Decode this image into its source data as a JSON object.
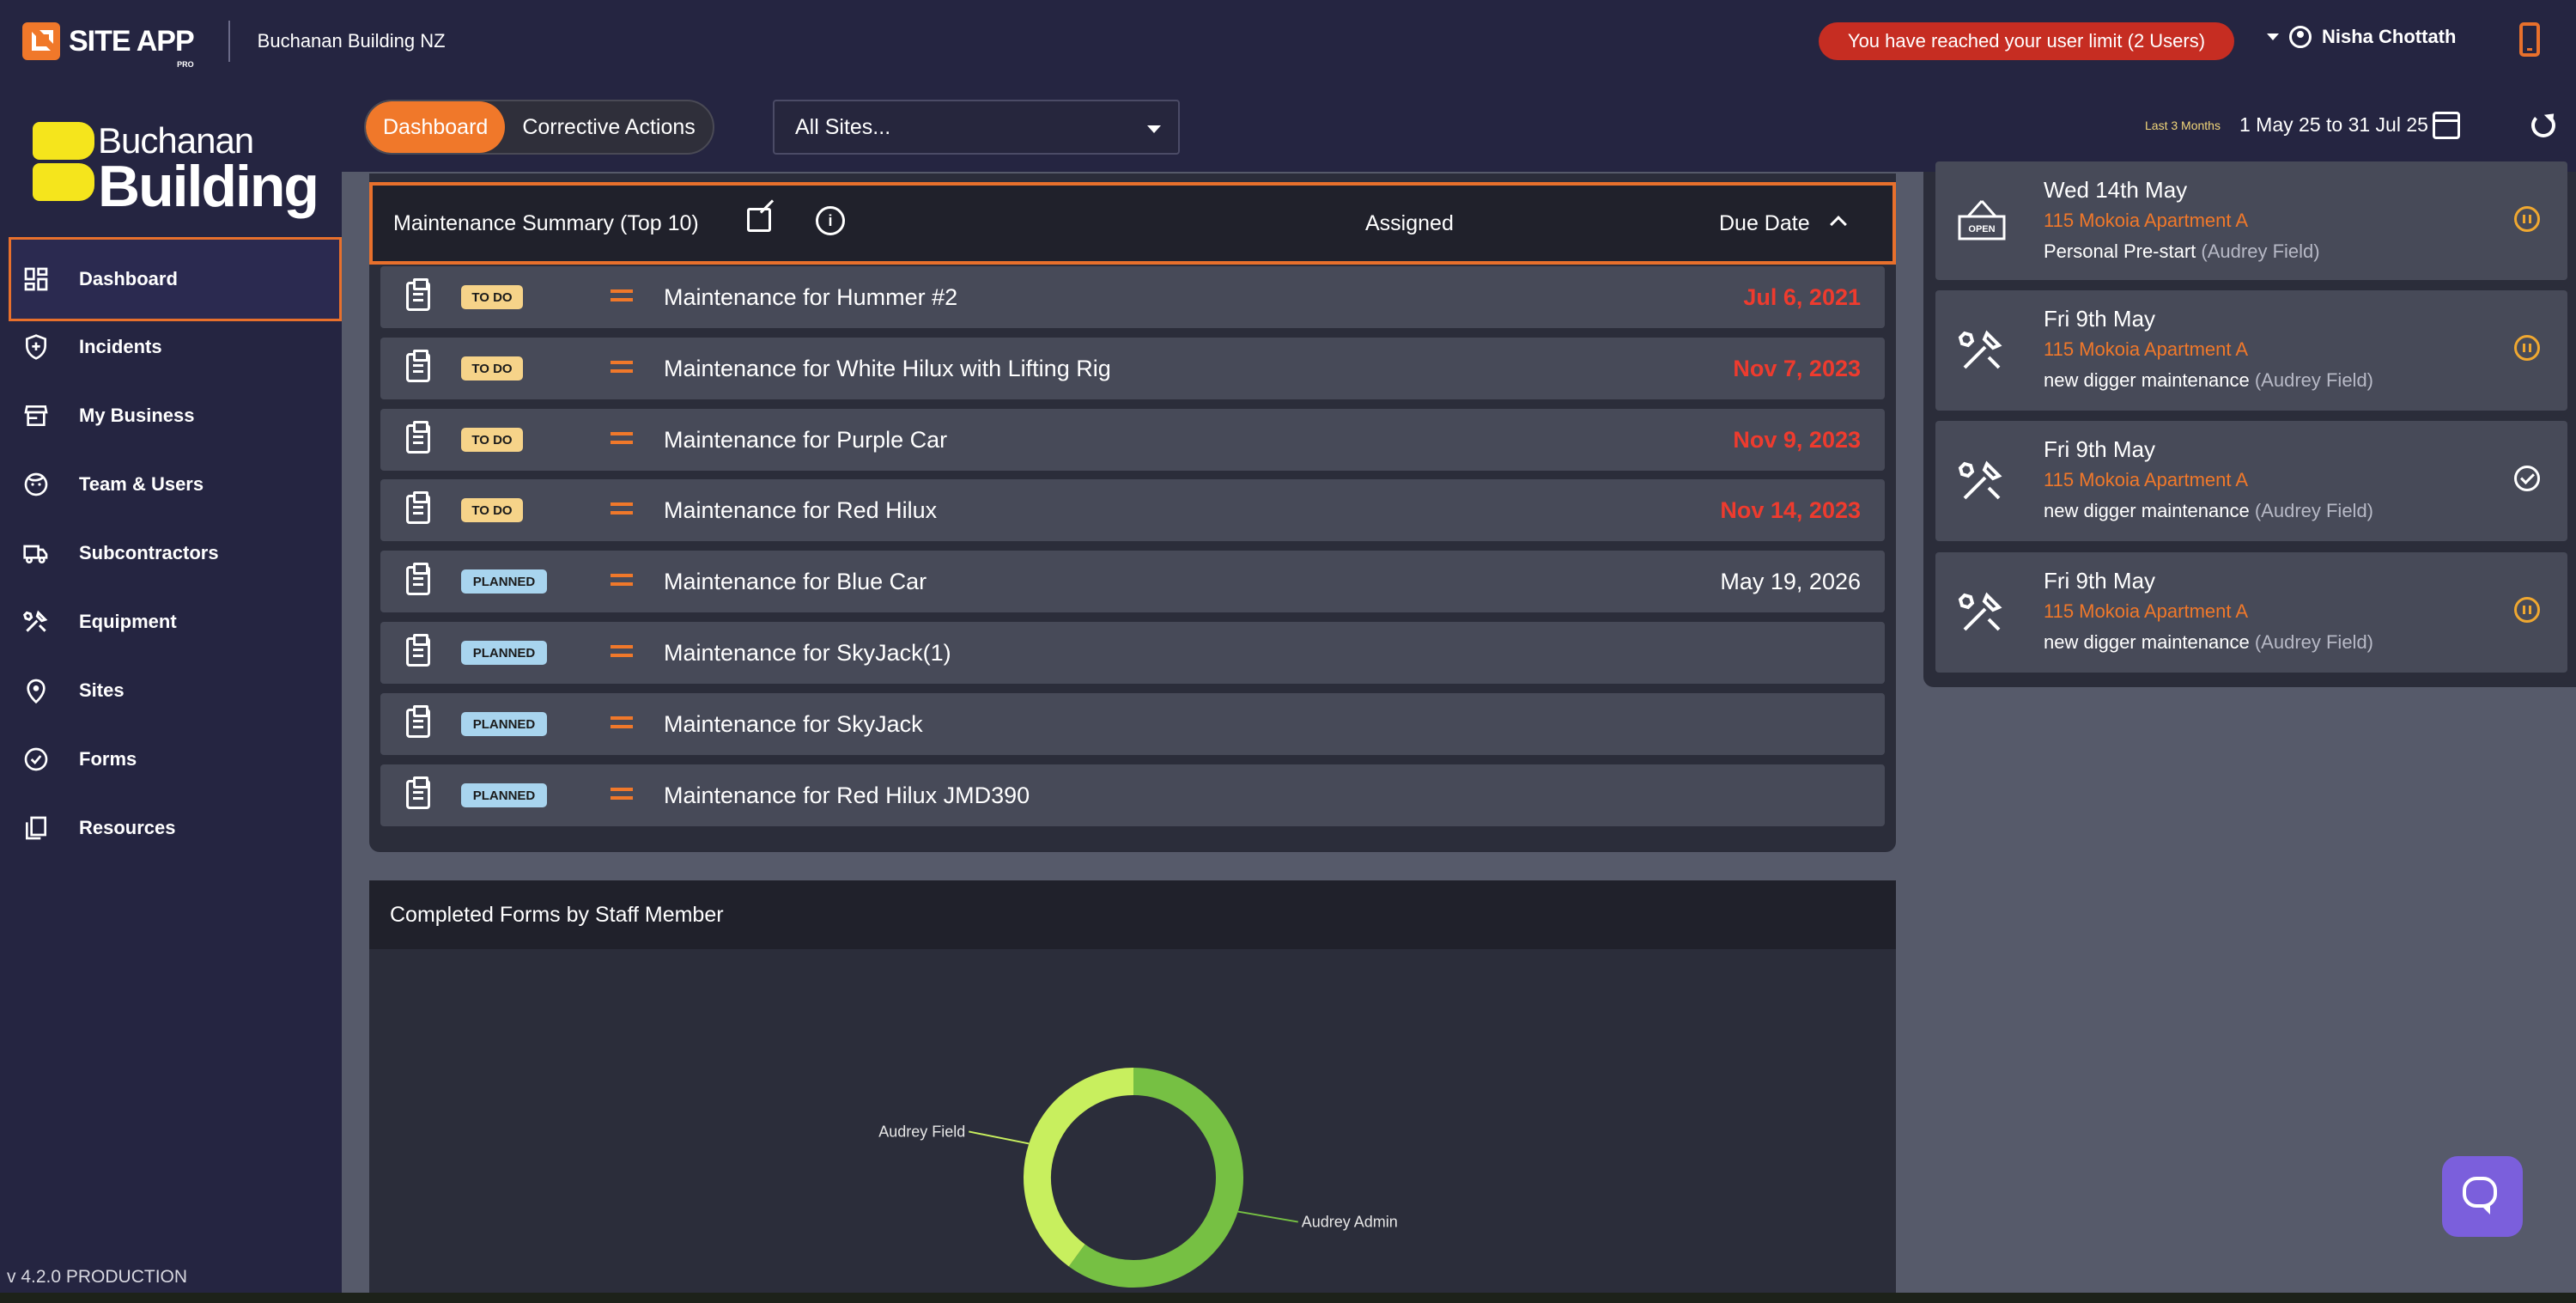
{
  "app": {
    "brand": "SITE APP",
    "brand_sub": "PRO",
    "company": "Buchanan Building NZ",
    "user_limit_message": "You have reached your user limit (2 Users)",
    "user_name": "Nisha Chottath"
  },
  "sidebar": {
    "logo_line1": "Buchanan",
    "logo_line2": "Building",
    "items": [
      {
        "label": "Dashboard",
        "icon": "dashboard-icon",
        "active": true
      },
      {
        "label": "Incidents",
        "icon": "shield-plus-icon"
      },
      {
        "label": "My Business",
        "icon": "store-icon"
      },
      {
        "label": "Team & Users",
        "icon": "face-icon"
      },
      {
        "label": "Subcontractors",
        "icon": "truck-icon"
      },
      {
        "label": "Equipment",
        "icon": "tools-icon"
      },
      {
        "label": "Sites",
        "icon": "location-pin-icon"
      },
      {
        "label": "Forms",
        "icon": "check-circle-icon"
      },
      {
        "label": "Resources",
        "icon": "copy-icon"
      }
    ],
    "version": "v 4.2.0 PRODUCTION"
  },
  "header": {
    "tabs": [
      {
        "label": "Dashboard",
        "active": true
      },
      {
        "label": "Corrective Actions",
        "active": false
      }
    ],
    "site_select": "All Sites...",
    "period_label": "Last 3 Months",
    "date_range": "1 May 25 to 31 Jul 25"
  },
  "maintenance": {
    "title": "Maintenance Summary (Top 10)",
    "col_assigned": "Assigned",
    "col_due": "Due Date",
    "rows": [
      {
        "status": "TO DO",
        "title": "Maintenance for Hummer #2",
        "due": "Jul 6, 2021",
        "overdue": true
      },
      {
        "status": "TO DO",
        "title": "Maintenance for White Hilux with Lifting Rig",
        "due": "Nov 7, 2023",
        "overdue": true
      },
      {
        "status": "TO DO",
        "title": "Maintenance for Purple Car",
        "due": "Nov 9, 2023",
        "overdue": true
      },
      {
        "status": "TO DO",
        "title": "Maintenance for Red Hilux",
        "due": "Nov 14, 2023",
        "overdue": true
      },
      {
        "status": "PLANNED",
        "title": "Maintenance for Blue Car",
        "due": "May 19, 2026",
        "overdue": false
      },
      {
        "status": "PLANNED",
        "title": "Maintenance for SkyJack(1)",
        "due": "",
        "overdue": false
      },
      {
        "status": "PLANNED",
        "title": "Maintenance for SkyJack",
        "due": "",
        "overdue": false
      },
      {
        "status": "PLANNED",
        "title": "Maintenance for Red Hilux JMD390",
        "due": "",
        "overdue": false
      }
    ]
  },
  "forms_chart": {
    "title": "Completed Forms by Staff Member"
  },
  "chart_data": {
    "type": "pie",
    "donut": true,
    "title": "Completed Forms by Staff Member",
    "categories": [
      "Audrey Admin",
      "Audrey Field"
    ],
    "values": [
      60,
      40
    ],
    "colors": [
      "#76c043",
      "#c8ef5e"
    ]
  },
  "activity": [
    {
      "date": "Wed 14th May",
      "site": "115 Mokoia Apartment A",
      "desc": "Personal Pre-start",
      "who": "(Audrey Field)",
      "icon": "open-sign-icon",
      "status": "in-progress"
    },
    {
      "date": "Fri 9th May",
      "site": "115 Mokoia Apartment A",
      "desc": "new digger maintenance",
      "who": "(Audrey Field)",
      "icon": "tools-icon",
      "status": "in-progress"
    },
    {
      "date": "Fri 9th May",
      "site": "115 Mokoia Apartment A",
      "desc": "new digger maintenance",
      "who": "(Audrey Field)",
      "icon": "tools-icon",
      "status": "complete"
    },
    {
      "date": "Fri 9th May",
      "site": "115 Mokoia Apartment A",
      "desc": "new digger maintenance",
      "who": "(Audrey Field)",
      "icon": "tools-icon",
      "status": "in-progress"
    }
  ]
}
